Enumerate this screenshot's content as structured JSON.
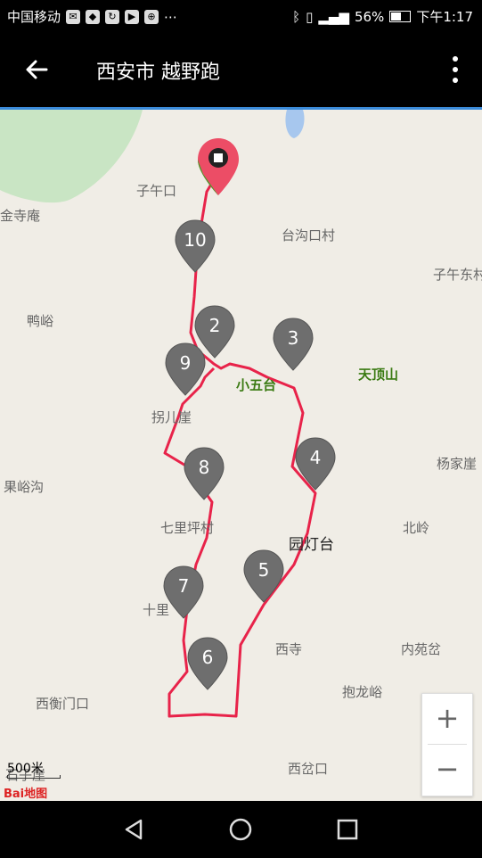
{
  "status_bar": {
    "carrier": "中国移动",
    "battery": "56%",
    "time": "下午1:17"
  },
  "app_bar": {
    "title": "西安市 越野跑"
  },
  "map": {
    "labels": {
      "ziwukou": "子午口",
      "jinsian": "金寺庵",
      "taigoukoucun": "台沟口村",
      "ziwudong": "子午东村",
      "geyu": "鸭峪",
      "tiandingshan": "天顶山",
      "xiaowutai": "小五台",
      "guaierya": "拐儿崖",
      "yangjiaya": "杨家崖",
      "guoyugou": "果峪沟",
      "qilipingcun": "七里坪村",
      "yuandengtai": "园灯台",
      "beiling": "北岭",
      "shili": "十里",
      "xisi": "西寺",
      "neiyuancha": "内苑岔",
      "baolongyu": "抱龙峪",
      "xihengmenkou": "西衡门口",
      "xichakou": "西岔口",
      "shiziya": "石子崖"
    },
    "markers": [
      "10",
      "2",
      "3",
      "9",
      "4",
      "8",
      "5",
      "7",
      "6"
    ],
    "zoom_in": "+",
    "zoom_out": "−",
    "scale": "500米",
    "logo": "Bai地图",
    "route_color": "#e8234a"
  },
  "nav_bar": {
    "back": "back",
    "home": "home",
    "recent": "recent"
  }
}
